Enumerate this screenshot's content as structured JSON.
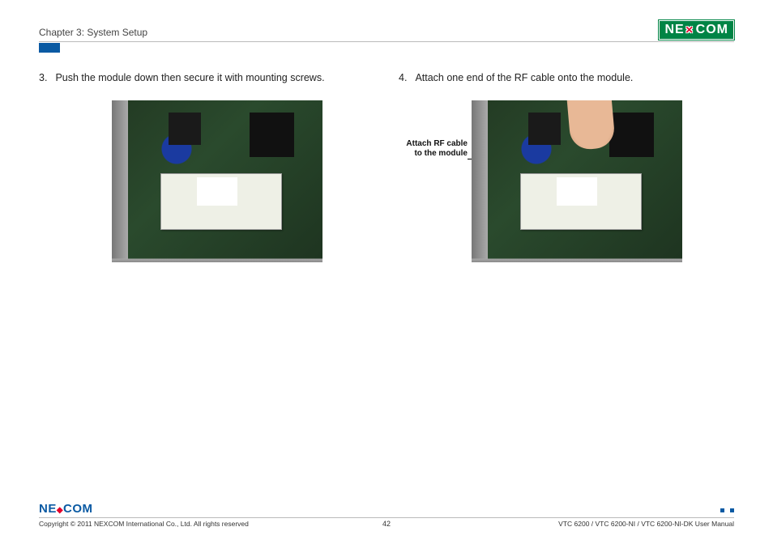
{
  "header": {
    "chapter": "Chapter 3: System Setup",
    "logo_text": "NEXCOM"
  },
  "steps": {
    "left": {
      "num": "3.",
      "text": "Push the module down then secure it with mounting screws."
    },
    "right": {
      "num": "4.",
      "text": "Attach one end of the RF cable onto the module.",
      "callout": "Attach RF cable to the module"
    }
  },
  "footer": {
    "copyright": "Copyright © 2011 NEXCOM International Co., Ltd. All rights reserved",
    "page_number": "42",
    "doc_title": "VTC 6200 / VTC 6200-NI / VTC 6200-NI-DK User Manual",
    "logo_text": "NEXCOM"
  }
}
